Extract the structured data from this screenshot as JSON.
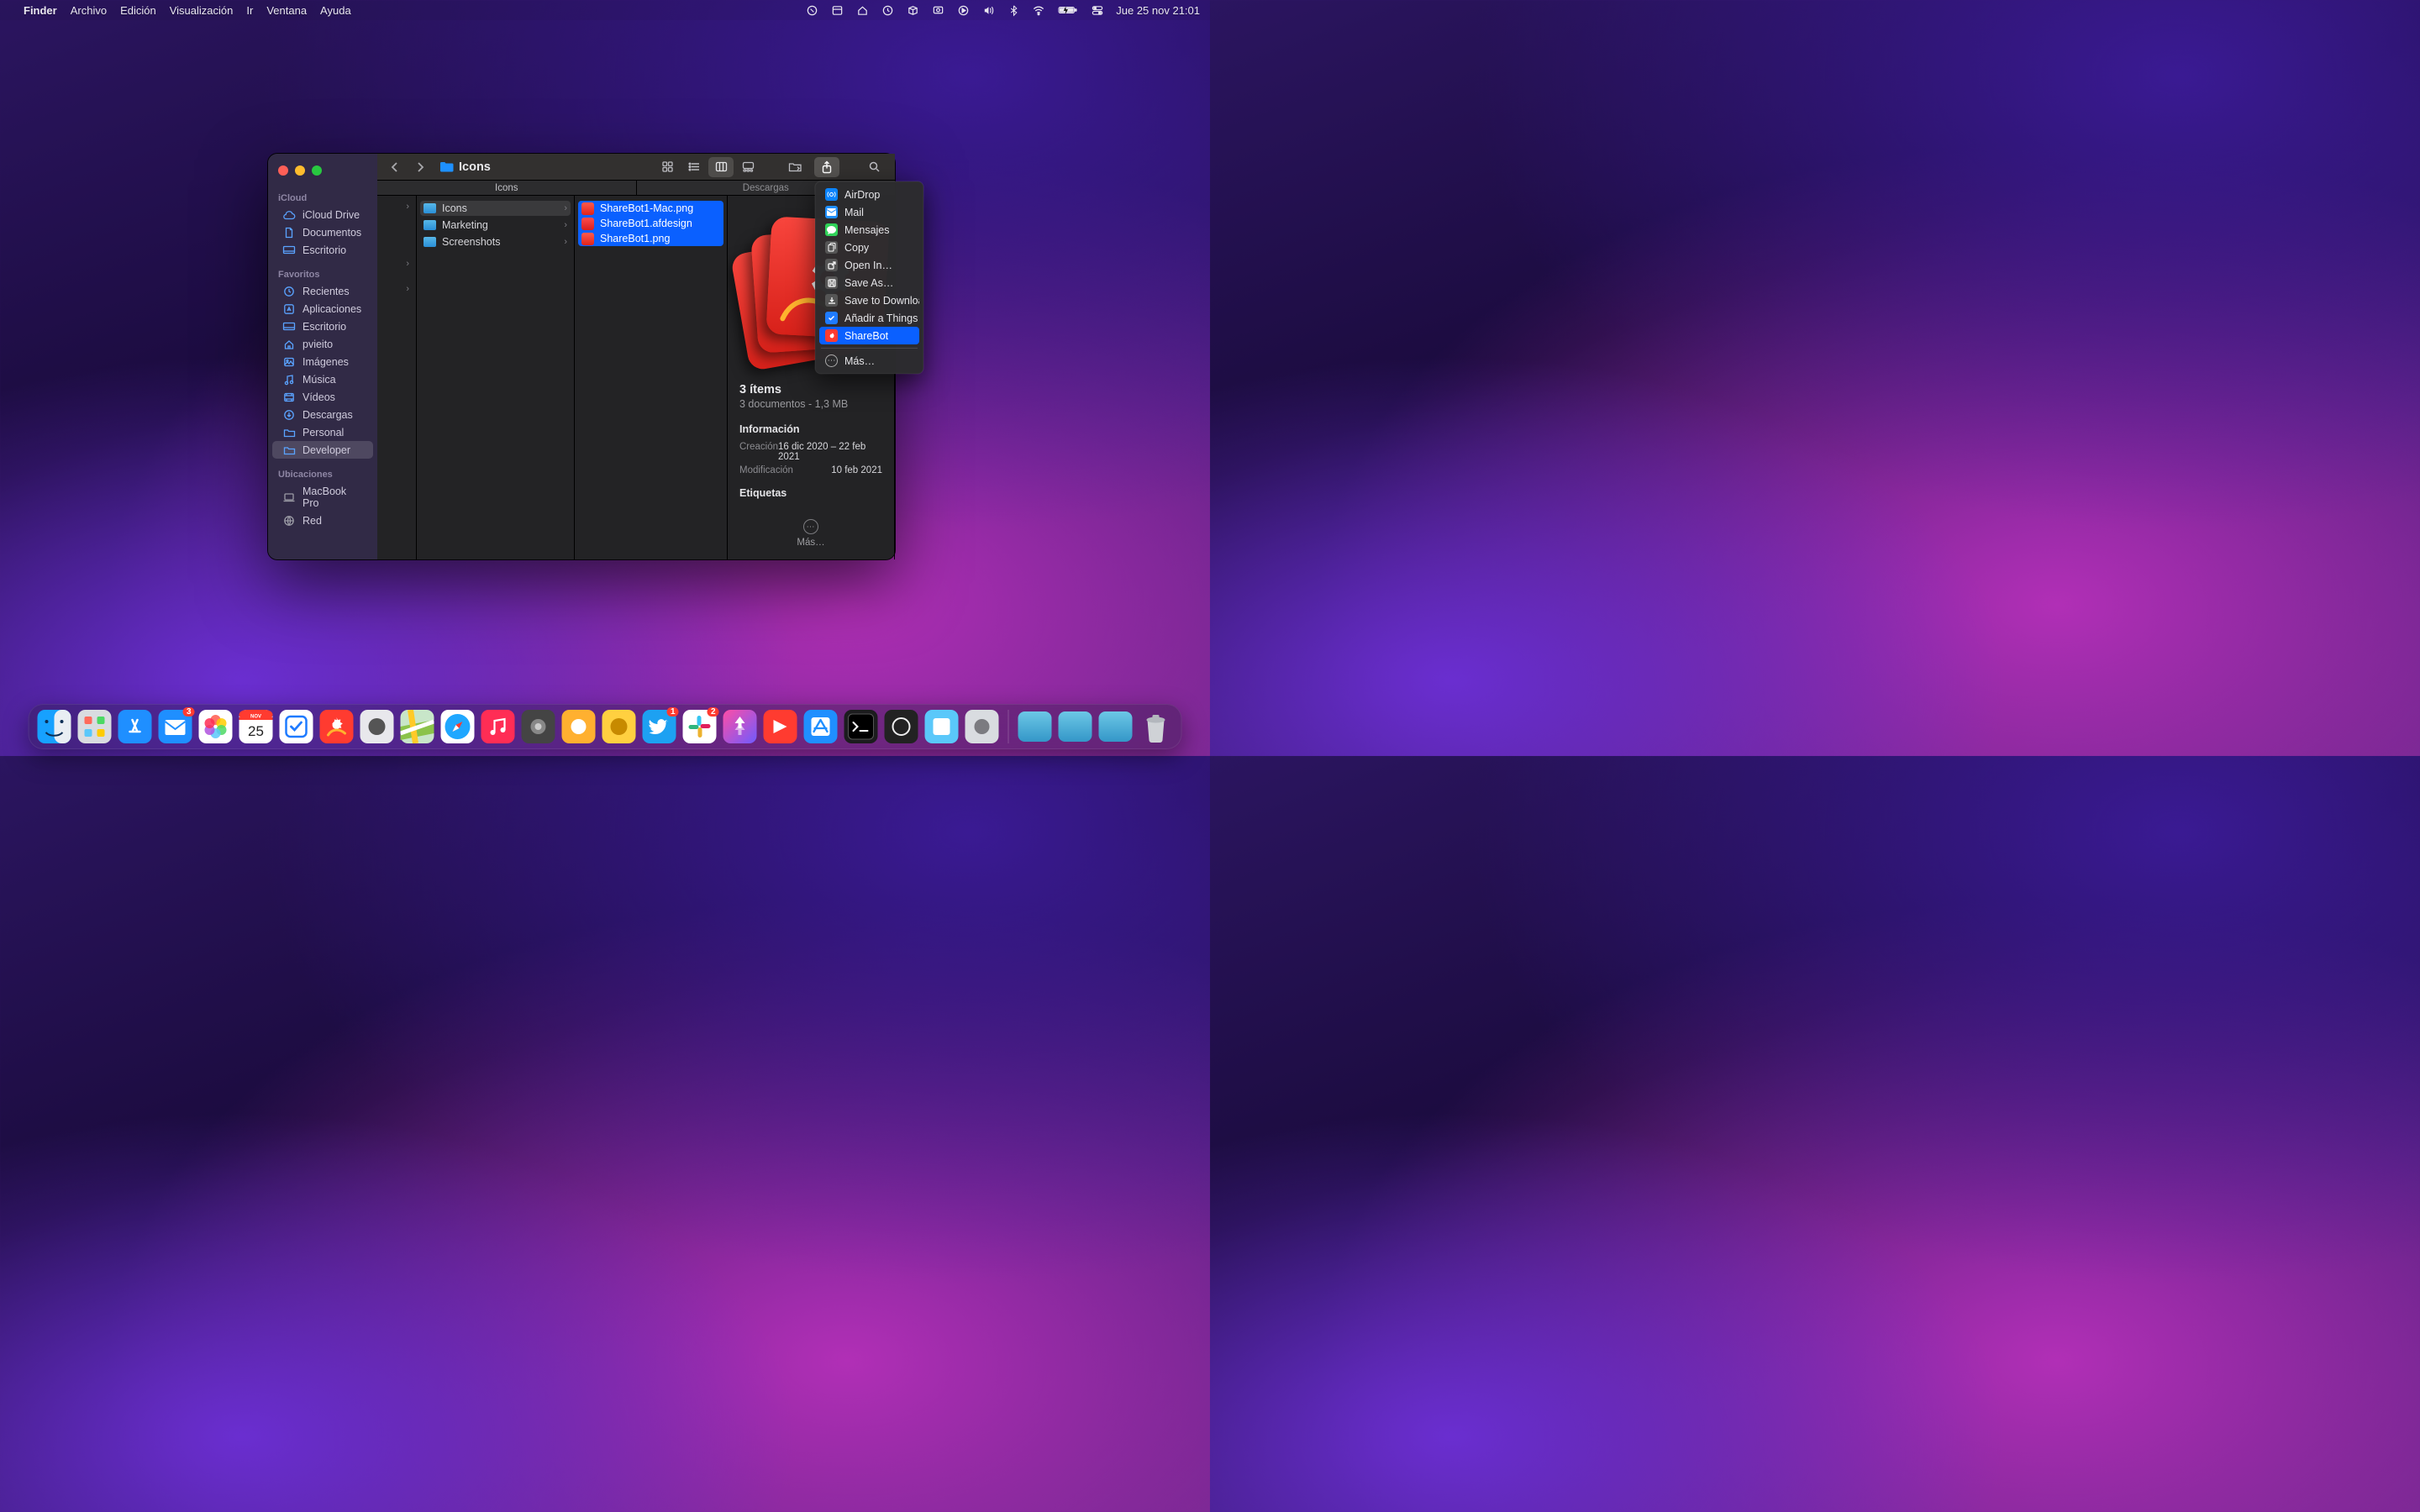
{
  "menubar": {
    "app": "Finder",
    "items": [
      "Archivo",
      "Edición",
      "Visualización",
      "Ir",
      "Ventana",
      "Ayuda"
    ],
    "datetime": "Jue 25 nov  21:01"
  },
  "finder": {
    "title": "Icons",
    "path_tabs": [
      "Icons",
      "Descargas"
    ],
    "sidebar": {
      "sections": [
        {
          "label": "iCloud",
          "items": [
            {
              "icon": "cloud",
              "label": "iCloud Drive"
            },
            {
              "icon": "doc",
              "label": "Documentos"
            },
            {
              "icon": "desktop",
              "label": "Escritorio"
            }
          ]
        },
        {
          "label": "Favoritos",
          "items": [
            {
              "icon": "clock",
              "label": "Recientes"
            },
            {
              "icon": "apps",
              "label": "Aplicaciones"
            },
            {
              "icon": "desktop",
              "label": "Escritorio"
            },
            {
              "icon": "home",
              "label": "pvieito"
            },
            {
              "icon": "photo",
              "label": "Imágenes"
            },
            {
              "icon": "music",
              "label": "Música"
            },
            {
              "icon": "video",
              "label": "Vídeos"
            },
            {
              "icon": "download",
              "label": "Descargas"
            },
            {
              "icon": "folder",
              "label": "Personal"
            },
            {
              "icon": "folder",
              "label": "Developer",
              "selected": true
            }
          ]
        },
        {
          "label": "Ubicaciones",
          "items": [
            {
              "icon": "laptop",
              "label": "MacBook Pro",
              "gray": true
            },
            {
              "icon": "globe",
              "label": "Red",
              "gray": true
            }
          ]
        }
      ]
    },
    "columns": {
      "c2": [
        {
          "label": "Icons",
          "type": "folder",
          "selected": true,
          "chevron": true
        },
        {
          "label": "Marketing",
          "type": "folder",
          "chevron": true
        },
        {
          "label": "Screenshots",
          "type": "folder",
          "chevron": true
        }
      ],
      "c3": [
        {
          "label": "ShareBot1-Mac.png",
          "type": "red",
          "selected": true
        },
        {
          "label": "ShareBot1.afdesign",
          "type": "sb",
          "selected": true
        },
        {
          "label": "ShareBot1.png",
          "type": "red",
          "selected": true
        }
      ]
    },
    "preview": {
      "count_title": "3 ítems",
      "count_sub": "3 documentos - 1,3 MB",
      "info_label": "Información",
      "created_k": "Creación",
      "created_v": "16 dic 2020 – 22 feb 2021",
      "modified_k": "Modificación",
      "modified_v": "10 feb 2021",
      "tags_label": "Etiquetas",
      "more_label": "Más…"
    }
  },
  "share_menu": {
    "items": [
      {
        "label": "AirDrop",
        "color": "#2a8fff"
      },
      {
        "label": "Mail",
        "color": "#2a8fff"
      },
      {
        "label": "Mensajes",
        "color": "#30d158"
      },
      {
        "label": "Copy",
        "color": "#8e8e93"
      },
      {
        "label": "Open In…",
        "color": "#8e8e93"
      },
      {
        "label": "Save As…",
        "color": "#8e8e93"
      },
      {
        "label": "Save to Downloads",
        "color": "#8e8e93"
      },
      {
        "label": "Añadir a Things",
        "color": "#1f7bff"
      },
      {
        "label": "ShareBot",
        "color": "#ff3b30",
        "highlighted": true
      }
    ],
    "more": "Más…"
  }
}
